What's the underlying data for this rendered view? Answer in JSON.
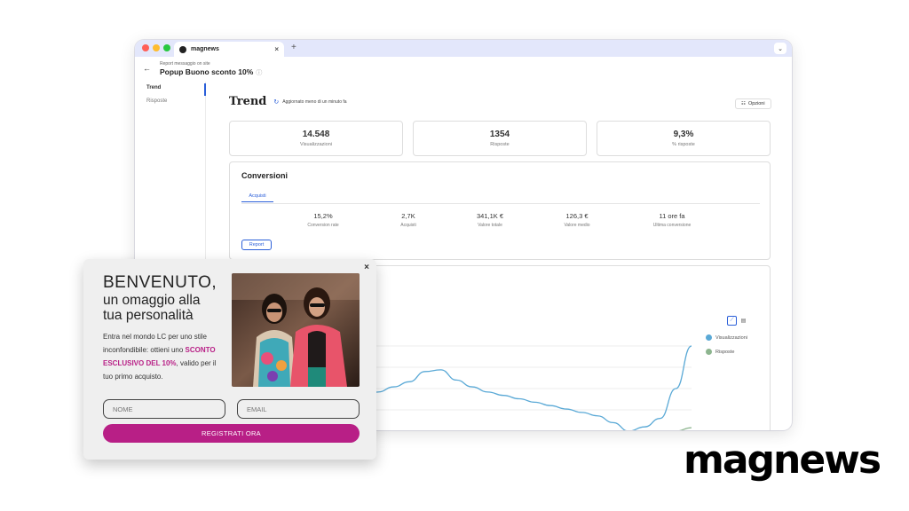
{
  "colors": {
    "accent": "#2b5fd9",
    "brand_magenta": "#b81f86",
    "series_views": "#5aa9d6",
    "series_responses": "#8db58f"
  },
  "browser": {
    "tab_title": "magnews",
    "tab_close": "×",
    "new_tab": "+",
    "menu_icon": "⌄"
  },
  "header": {
    "back_icon": "←",
    "breadcrumb": "Report messaggio on site",
    "title": "Popup Buono sconto 10%",
    "info_icon": "ⓘ"
  },
  "sidebar": {
    "items": [
      {
        "label": "Trend"
      },
      {
        "label": "Risposte"
      }
    ]
  },
  "trend": {
    "title": "Trend",
    "refresh_icon": "↻",
    "updated": "Aggiornato meno di un minuto fa",
    "options_icon": "☷",
    "options_label": "Opzioni"
  },
  "kpis": [
    {
      "value": "14.548",
      "label": "Visualizzazioni"
    },
    {
      "value": "1354",
      "label": "Risposte"
    },
    {
      "value": "9,3%",
      "label": "% risposte"
    }
  ],
  "conversions": {
    "title": "Conversioni",
    "tab": "Acquisti",
    "stats": [
      {
        "value": "15,2%",
        "label": "Conversion rate"
      },
      {
        "value": "2,7K",
        "label": "Acquisti"
      },
      {
        "value": "341,1K €",
        "label": "Valore totale"
      },
      {
        "value": "126,3 €",
        "label": "Valore medio"
      },
      {
        "value": "11 ore fa",
        "label": "Ultima conversione"
      }
    ],
    "report_button": "Report"
  },
  "chart": {
    "line_icon": "📈",
    "table_icon": "▤",
    "legend": [
      {
        "label": "Visualizzazioni"
      },
      {
        "label": "Risposte"
      }
    ]
  },
  "chart_data": {
    "type": "line",
    "series": [
      {
        "name": "Visualizzazioni",
        "values": [
          82,
          70,
          74,
          68,
          62,
          58,
          50,
          44,
          42,
          46,
          52,
          58,
          70,
          72,
          60,
          52,
          46,
          42,
          38,
          34,
          30,
          26,
          22,
          18,
          10,
          0,
          5,
          15,
          50,
          100
        ]
      },
      {
        "name": "Risposte",
        "values": [
          0,
          0,
          0,
          0,
          0,
          0,
          0,
          0,
          0,
          0,
          0,
          0,
          0,
          0,
          0,
          0,
          0,
          0,
          0,
          0,
          0,
          0,
          0,
          0,
          0,
          0,
          0,
          0,
          0,
          4
        ]
      }
    ]
  },
  "popup": {
    "close": "×",
    "headline_1": "BENVENUTO,",
    "headline_2": "un omaggio alla",
    "headline_3": "tua personalità",
    "body_1": "Entra nel mondo LC per uno stile inconfondibile: ottieni uno",
    "highlight": "SCONTO ESCLUSIVO DEL 10%",
    "body_2": ", valido per il tuo primo acquisto.",
    "name_placeholder": "NOME",
    "email_placeholder": "EMAIL",
    "submit": "REGISTRATI ORA"
  },
  "brand": {
    "logo_text": "magnews"
  }
}
